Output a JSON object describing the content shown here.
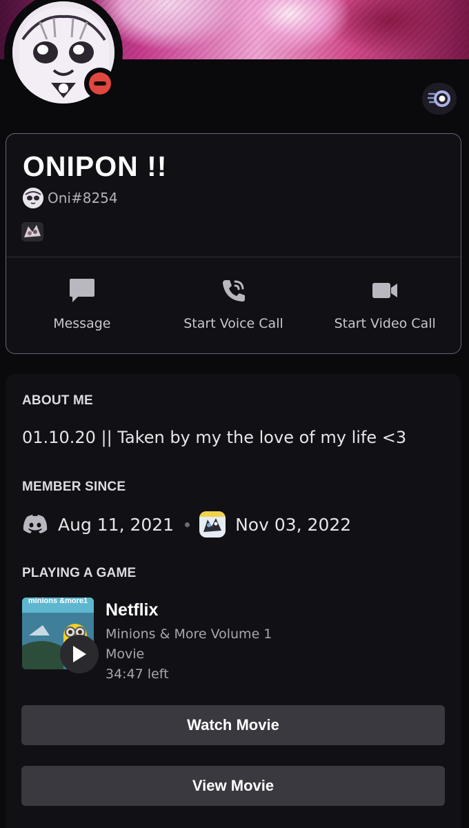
{
  "profile": {
    "display_name": "ONIPON !!",
    "username": "Oni#8254",
    "status": "do-not-disturb",
    "status_color": "#e0473f",
    "nitro_icon": "nitro-badge-icon"
  },
  "actions": [
    {
      "label": "Message",
      "icon": "chat-bubble-icon"
    },
    {
      "label": "Start Voice Call",
      "icon": "phone-call-icon"
    },
    {
      "label": "Start Video Call",
      "icon": "video-camera-icon"
    }
  ],
  "about": {
    "title": "ABOUT ME",
    "text": "01.10.20  ||  Taken by my the love of my life <3"
  },
  "member_since": {
    "title": "MEMBER SINCE",
    "discord_date": "Aug 11, 2021",
    "server_date": "Nov 03, 2022"
  },
  "activity": {
    "title": "PLAYING A GAME",
    "app": "Netflix",
    "details": "Minions & More Volume 1",
    "state": "Movie",
    "time_left": "34:47 left",
    "art_text": "minions &more1",
    "buttons": [
      "Watch Movie",
      "View Movie"
    ]
  },
  "colors": {
    "background": "#0a090c",
    "card": "#111014",
    "button": "#3a3940",
    "accent_border": "#6a6779"
  }
}
